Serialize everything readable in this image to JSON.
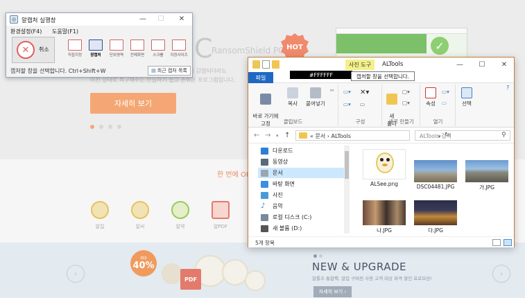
{
  "background_site": {
    "brand_letter": "C",
    "brand_name": "RansomShield PC",
    "hot_badge": "HOT",
    "desc_line1": "웨어에 감염되더라도",
    "desc_line2": "이전 상태로 복구해주는 안심하기 쉽고 손쉬운 프로그램입니다.",
    "detail_button": "자세히 보기",
    "tagline": "한 번에 OK! 알툴",
    "apps": [
      {
        "label": "알집"
      },
      {
        "label": "알씨"
      },
      {
        "label": "알약"
      },
      {
        "label": "알PDF"
      }
    ],
    "promo_badge_small": "최대",
    "promo_badge_big": "40%",
    "pdf_tag": "PDF",
    "new_upgrade_title": "NEW & UPGRADE",
    "new_upgrade_sub": "알툴즈 통합팩, 알집 구버전 사용 고객 대상 파격 할인 프로모션!",
    "new_upgrade_button": "자세히 보기 ›",
    "arrow_left": "‹",
    "arrow_right": "›"
  },
  "capture_window": {
    "title": "알캡처 실행창",
    "controls": {
      "minimize": "—",
      "maximize": "☐",
      "close": "✕"
    },
    "menu": [
      "환경설정(F4)",
      "도움말(F1)"
    ],
    "cancel_label": "취소",
    "tools": [
      {
        "label": "직접지정",
        "selected": false
      },
      {
        "label": "창캡처",
        "selected": true
      },
      {
        "label": "단위영역",
        "selected": false
      },
      {
        "label": "전체화면",
        "selected": false
      },
      {
        "label": "스크롤",
        "selected": false
      },
      {
        "label": "지정사이즈",
        "selected": false
      }
    ],
    "status": "캡처할 창을 선택합니다. Ctrl+Shift+W",
    "recent_button": "최근 캡처 목록"
  },
  "explorer": {
    "file_tab": "파일",
    "hex_label": "#FFFFFF",
    "context_tab": "사진 도구",
    "title": "ALTools",
    "tooltip": "캡처할 창을 선택합니다.",
    "controls": {
      "minimize": "—",
      "maximize": "☐",
      "close": "✕"
    },
    "ribbon": {
      "clipboard": {
        "label": "클립보드",
        "pin": "바로 가기에\n고정",
        "copy": "복사",
        "paste": "붙여넣기"
      },
      "organize": {
        "label": "구성"
      },
      "new": {
        "label": "새로 만들기",
        "new_folder": "새\n폴더"
      },
      "open": {
        "label": "열기",
        "properties": "속성"
      },
      "select": {
        "label": "",
        "select_btn": "선택"
      }
    },
    "address": {
      "prefix": "«",
      "path1": "문서",
      "sep": "›",
      "path2": "ALTools"
    },
    "search_placeholder": "ALTools 검색",
    "nav_items": [
      {
        "label": "다운로드",
        "color": "#2d7fd3"
      },
      {
        "label": "동영상",
        "color": "#5b6a7a"
      },
      {
        "label": "문서",
        "color": "#9aa6b4",
        "selected": true
      },
      {
        "label": "바탕 화면",
        "color": "#3a8fe0"
      },
      {
        "label": "사진",
        "color": "#4a9ad8"
      },
      {
        "label": "음악",
        "color": "#2d7fd3"
      },
      {
        "label": "로컬 디스크 (C:)",
        "color": "#7a8a9a"
      },
      {
        "label": "새 볼륨 (D:)",
        "color": "#555555"
      }
    ],
    "files": [
      {
        "name": "ALSee.png",
        "kind": "mascot"
      },
      {
        "name": "DSC04481.JPG",
        "kind": "building"
      },
      {
        "name": "가.JPG",
        "kind": "palace"
      },
      {
        "name": "나.JPG",
        "kind": "street"
      },
      {
        "name": "다.JPG",
        "kind": "night"
      }
    ],
    "status": "5개 항목"
  }
}
